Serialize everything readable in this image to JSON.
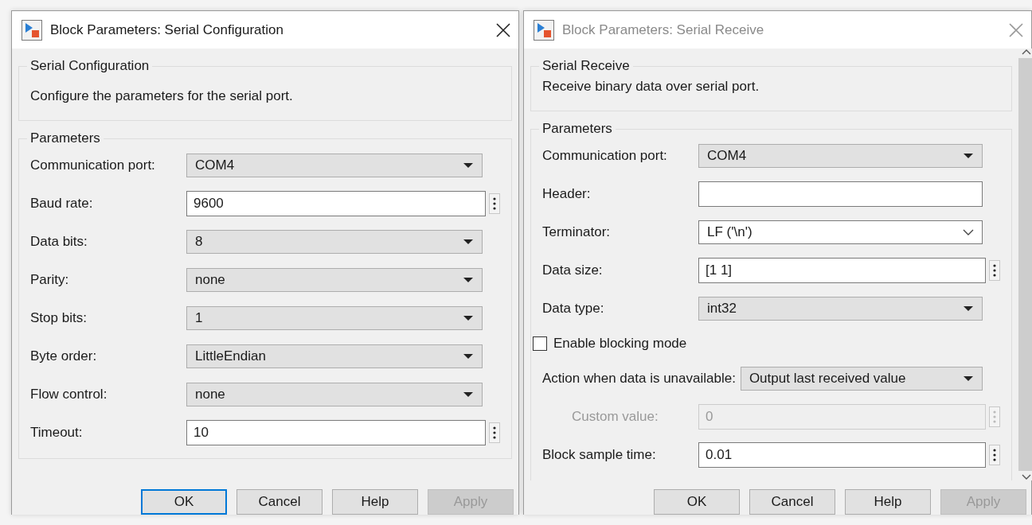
{
  "dialogs": [
    {
      "title": "Block Parameters: Serial Configuration",
      "active": true,
      "scrollable": false,
      "description": {
        "title": "Serial Configuration",
        "text": "Configure the parameters for the serial port."
      },
      "parameters": {
        "title": "Parameters",
        "rows": [
          {
            "kind": "dropdown",
            "label": "Communication port:",
            "value": "COM4",
            "disabled": false
          },
          {
            "kind": "edit",
            "label": "Baud rate:",
            "value": "9600",
            "disabled": false
          },
          {
            "kind": "dropdown",
            "label": "Data bits:",
            "value": "8",
            "disabled": false
          },
          {
            "kind": "dropdown",
            "label": "Parity:",
            "value": "none",
            "disabled": false
          },
          {
            "kind": "dropdown",
            "label": "Stop bits:",
            "value": "1",
            "disabled": false
          },
          {
            "kind": "dropdown",
            "label": "Byte order:",
            "value": "LittleEndian",
            "disabled": false
          },
          {
            "kind": "dropdown",
            "label": "Flow control:",
            "value": "none",
            "disabled": false
          },
          {
            "kind": "edit",
            "label": "Timeout:",
            "value": "10",
            "disabled": false
          }
        ]
      },
      "buttons": [
        {
          "label": "OK",
          "default": true,
          "disabled": false
        },
        {
          "label": "Cancel",
          "default": false,
          "disabled": false
        },
        {
          "label": "Help",
          "default": false,
          "disabled": false
        },
        {
          "label": "Apply",
          "default": false,
          "disabled": true
        }
      ]
    },
    {
      "title": "Block Parameters: Serial Receive",
      "active": false,
      "scrollable": true,
      "description": {
        "title": "Serial Receive",
        "text": "Receive binary data over serial port."
      },
      "parameters": {
        "title": "Parameters",
        "rows": [
          {
            "kind": "dropdown",
            "label": "Communication port:",
            "value": "COM4",
            "disabled": false
          },
          {
            "kind": "text",
            "label": "Header:",
            "disabled": false
          },
          {
            "kind": "combo",
            "label": "Terminator:",
            "value": "LF ('\\n')",
            "disabled": false
          },
          {
            "kind": "edit",
            "label": "Data size:",
            "value": "[1 1]",
            "disabled": false
          },
          {
            "kind": "dropdown",
            "label": "Data type:",
            "value": "int32",
            "disabled": false
          },
          {
            "kind": "checkbox",
            "label": "Enable blocking mode",
            "checked": false,
            "disabled": false
          },
          {
            "kind": "dropdown",
            "label": "Action when data is unavailable:",
            "value": "Output last received value",
            "disabled": false,
            "children": [
              {
                "kind": "edit",
                "label": "Custom value:",
                "value": "0",
                "disabled": true
              }
            ]
          },
          {
            "kind": "edit",
            "label": "Block sample time:",
            "value": "0.01",
            "disabled": false
          }
        ]
      },
      "buttons": [
        {
          "label": "OK",
          "default": false,
          "disabled": false
        },
        {
          "label": "Cancel",
          "default": false,
          "disabled": false
        },
        {
          "label": "Help",
          "default": false,
          "disabled": false
        },
        {
          "label": "Apply",
          "default": false,
          "disabled": true
        }
      ]
    }
  ]
}
